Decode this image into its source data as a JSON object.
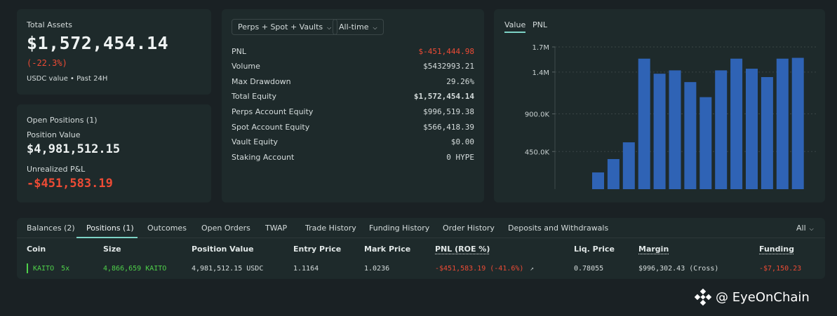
{
  "summary": {
    "total_assets_label": "Total Assets",
    "total_assets_value": "$1,572,454.14",
    "change": "(-22.3%)",
    "subtitle": "USDC value • Past 24H"
  },
  "open_positions": {
    "title": "Open Positions (1)",
    "position_value_label": "Position Value",
    "position_value": "$4,981,512.15",
    "unrealized_label": "Unrealized P&L",
    "unrealized_value": "-$451,583.19"
  },
  "stats": {
    "filter_label": "Perps + Spot + Vaults",
    "range_label": "All-time",
    "rows": [
      {
        "label": "PNL",
        "value": "$-451,444.98"
      },
      {
        "label": "Volume",
        "value": "$5432993.21"
      },
      {
        "label": "Max Drawdown",
        "value": "29.26%"
      },
      {
        "label": "Total Equity",
        "value": "$1,572,454.14"
      },
      {
        "label": "Perps Account Equity",
        "value": "$996,519.38"
      },
      {
        "label": "Spot Account Equity",
        "value": "$566,418.39"
      },
      {
        "label": "Vault Equity",
        "value": "$0.00"
      },
      {
        "label": "Staking Account",
        "value": "0 HYPE"
      }
    ]
  },
  "chart_tabs": {
    "value": "Value",
    "pnl": "PNL"
  },
  "chart_data": {
    "type": "bar",
    "title": "",
    "xlabel": "",
    "ylabel": "",
    "ylim": [
      0,
      1700000
    ],
    "yticks": [
      450000,
      900000,
      1400000,
      1700000
    ],
    "ytick_labels": [
      "450.0K",
      "900.0K",
      "1.4M",
      "1.7M"
    ],
    "values": [
      200000,
      360000,
      560000,
      1560000,
      1380000,
      1420000,
      1280000,
      1100000,
      1420000,
      1560000,
      1440000,
      1340000,
      1560000,
      1570000
    ],
    "color": "#2f63b5"
  },
  "tabs": [
    "Balances (2)",
    "Positions (1)",
    "Outcomes",
    "Open Orders",
    "TWAP",
    "Trade History",
    "Funding History",
    "Order History",
    "Deposits and Withdrawals"
  ],
  "filter_all": "All",
  "table": {
    "headers": [
      "Coin",
      "Size",
      "Position Value",
      "Entry Price",
      "Mark Price",
      "PNL (ROE %)",
      "Liq. Price",
      "Margin",
      "Funding"
    ],
    "row": {
      "coin": "KAITO",
      "leverage": "5x",
      "size": "4,866,659 KAITO",
      "position_value": "4,981,512.15 USDC",
      "entry_price": "1.1164",
      "mark_price": "1.0236",
      "pnl": "-$451,583.19 (-41.6%)",
      "liq_price": "0.78055",
      "margin": "$996,302.43 (Cross)",
      "funding": "-$7,150.23"
    }
  },
  "watermark": "@ EyeOnChain",
  "colors": {
    "accent": "#7dd3c6",
    "negative": "#ed4b35",
    "positive": "#4fd14a",
    "bar": "#2f63b5"
  }
}
